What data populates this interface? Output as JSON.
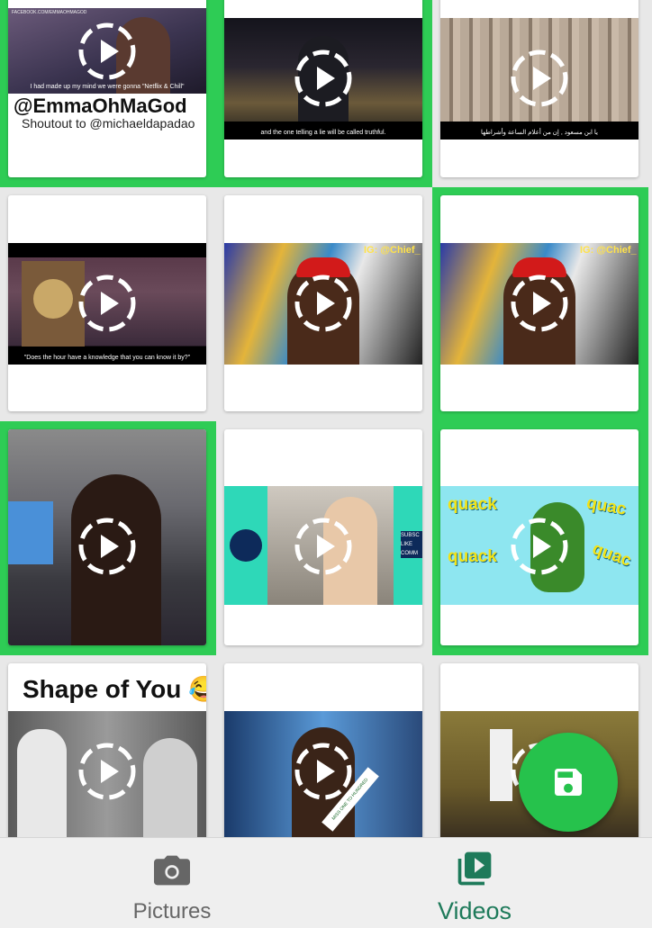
{
  "videos": [
    {
      "caption": "I had made up my mind we were gonna \"Netflix & Chill\"",
      "banner": "@EmmaOhMaGod",
      "sub": "Shoutout to @michaeldapadao",
      "top": "FACEBOOK.COM/EMMAOHMAGOD"
    },
    {
      "caption": "and the one telling a lie will be called truthful."
    },
    {
      "caption": "يا ابن مسعود , إن من أعلام الساعة وأشراطها"
    },
    {
      "caption": "\"Does the hour have a knowledge that you can know it by?\""
    },
    {
      "tag": "IG: @Chief_"
    },
    {
      "tag": "IG: @Chief_"
    },
    {},
    {
      "side": "SUBSC LIKE COMM"
    },
    {
      "word1": "quack",
      "word2": "quack",
      "word3": "quac",
      "word4": "quac"
    },
    {
      "title": "Shape of You 😂"
    },
    {
      "sash": "MISS ONE TO HUNDRED"
    },
    {}
  ],
  "tabs": {
    "pictures": "Pictures",
    "videos": "Videos"
  },
  "colors": {
    "selected": "#2ecc55",
    "fab": "#26c24c",
    "active_tab": "#1e7a5a",
    "inactive_tab": "#666666"
  }
}
